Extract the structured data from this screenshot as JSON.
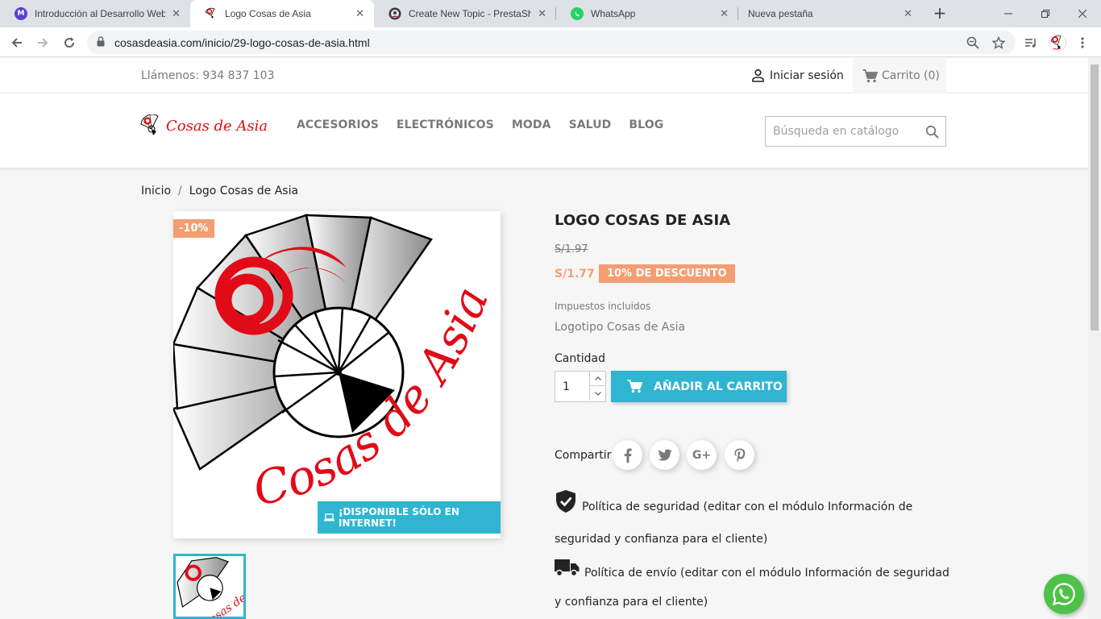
{
  "browser": {
    "tabs": [
      {
        "title": "Introducción al Desarrollo Web",
        "favicon": "moodle-icon",
        "active": false
      },
      {
        "title": "Logo Cosas de Asia",
        "favicon": "cosas-de-asia-icon",
        "active": true
      },
      {
        "title": "Create New Topic - PrestaShop",
        "favicon": "prestashop-icon",
        "active": false
      },
      {
        "title": "WhatsApp",
        "favicon": "whatsapp-icon",
        "active": false
      },
      {
        "title": "Nueva pestaña",
        "favicon": "",
        "active": false
      }
    ],
    "url": "cosasdeasia.com/inicio/29-logo-cosas-de-asia.html"
  },
  "header": {
    "call_us": "Llámenos: 934 837 103",
    "sign_in": "Iniciar sesión",
    "cart": "Carrito (0)",
    "logo_text": "Cosas de Asia",
    "menu": [
      "ACCESORIOS",
      "ELECTRÓNICOS",
      "MODA",
      "SALUD",
      "BLOG"
    ],
    "search_placeholder": "Búsqueda en catálogo"
  },
  "breadcrumb": [
    "Inicio",
    "Logo Cosas de Asia"
  ],
  "product": {
    "discount_flag": "-10%",
    "online_flag": "¡DISPONIBLE SÓLO EN INTERNET!",
    "title": "LOGO COSAS DE ASIA",
    "old_price": "S/1.97",
    "price": "S/1.77",
    "discount_badge": "10% DE DESCUENTO",
    "tax_note": "Impuestos incluidos",
    "description": "Logotipo Cosas de Asia",
    "quantity_label": "Cantidad",
    "quantity": "1",
    "add_to_cart": "AÑADIR AL CARRITO",
    "share_label": "Compartir",
    "image_text": "Cosas de Asia"
  },
  "reassurance": [
    {
      "icon": "shield-check-icon",
      "text": "Política de seguridad (editar con el módulo Información de seguridad y confianza para el cliente)"
    },
    {
      "icon": "truck-icon",
      "text": "Política de envío (editar con el módulo Información de seguridad y confianza para el cliente)"
    }
  ],
  "colors": {
    "accent": "#2fb5d2",
    "discount": "#f39d72",
    "brand_red": "#e10b17",
    "whatsapp": "#4dc247"
  }
}
